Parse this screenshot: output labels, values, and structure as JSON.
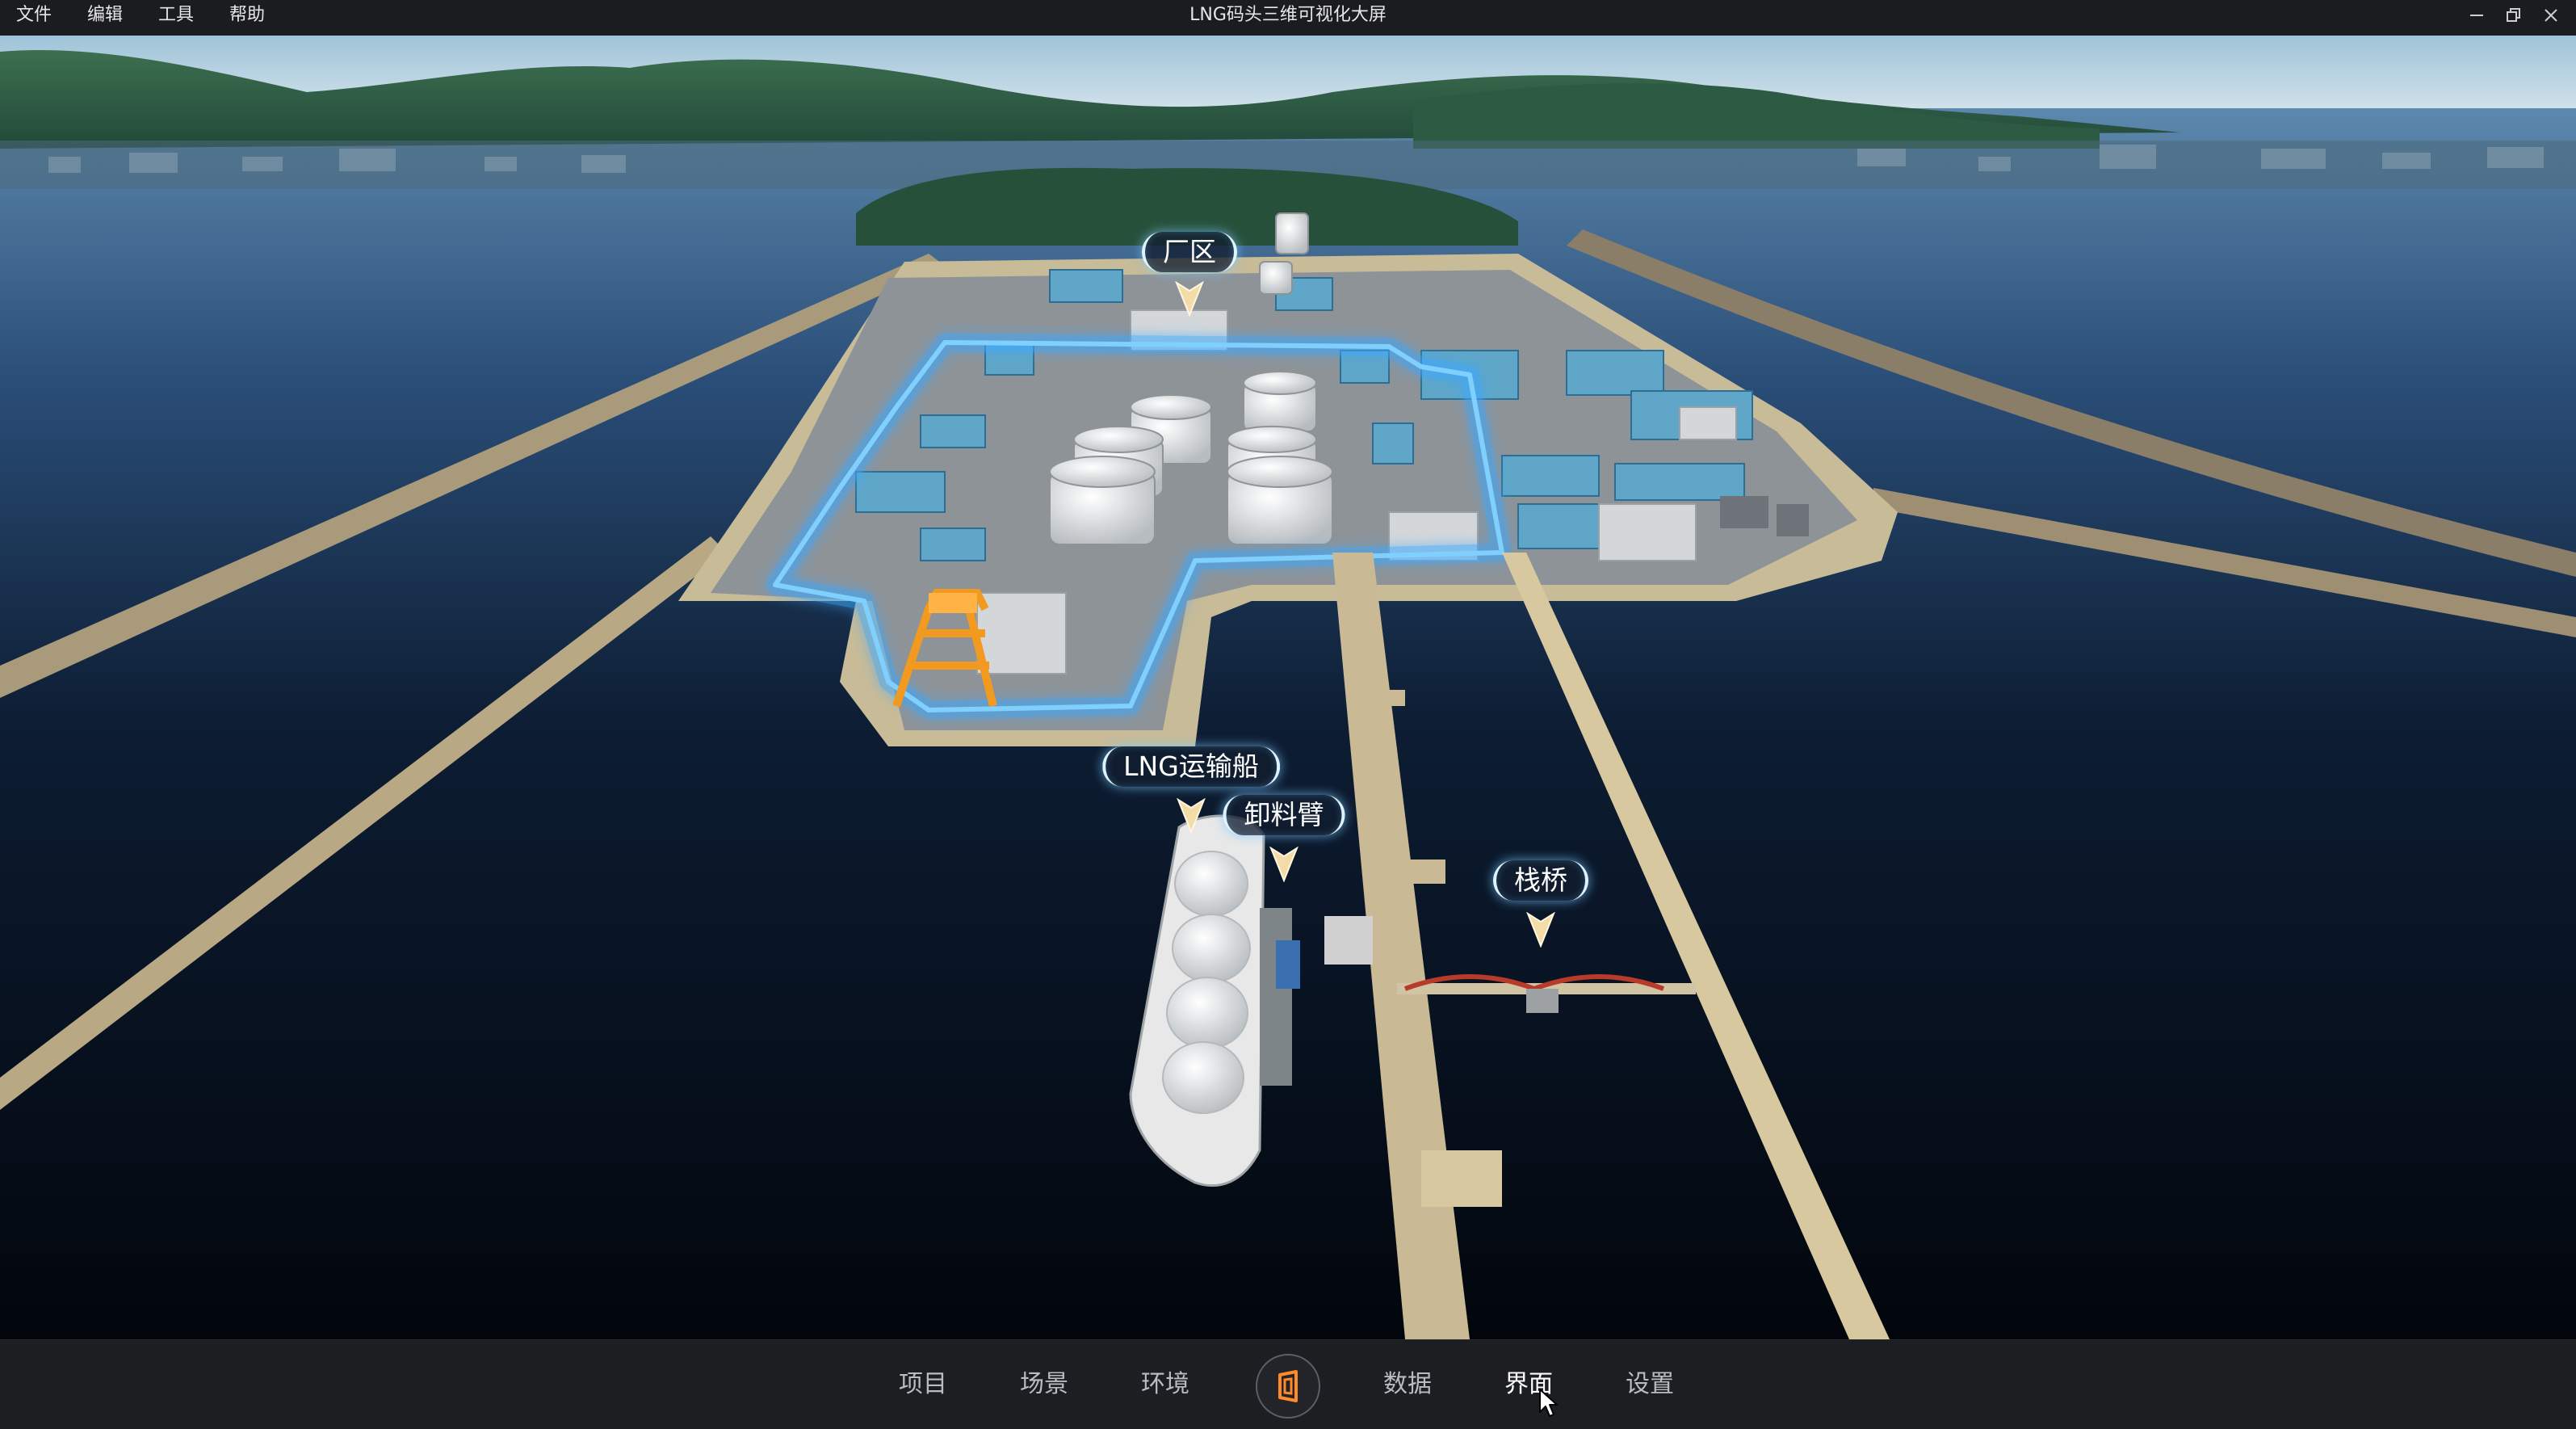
{
  "window": {
    "title": "LNG码头三维可视化大屏",
    "menu": [
      "文件",
      "编辑",
      "工具",
      "帮助"
    ],
    "controls": [
      "minimize-icon",
      "restore-icon",
      "close-icon"
    ]
  },
  "scene": {
    "labels": {
      "plant": "厂区",
      "ship": "LNG运输船",
      "arm": "卸料臂",
      "trestle": "栈桥"
    },
    "highlight_color": "#3aa8ff"
  },
  "bottom_nav": {
    "items": [
      "项目",
      "场景",
      "环境",
      "数据",
      "界面",
      "设置"
    ],
    "center_icon": "logo-icon",
    "active": "界面",
    "accent_color": "#ff8a2a"
  }
}
